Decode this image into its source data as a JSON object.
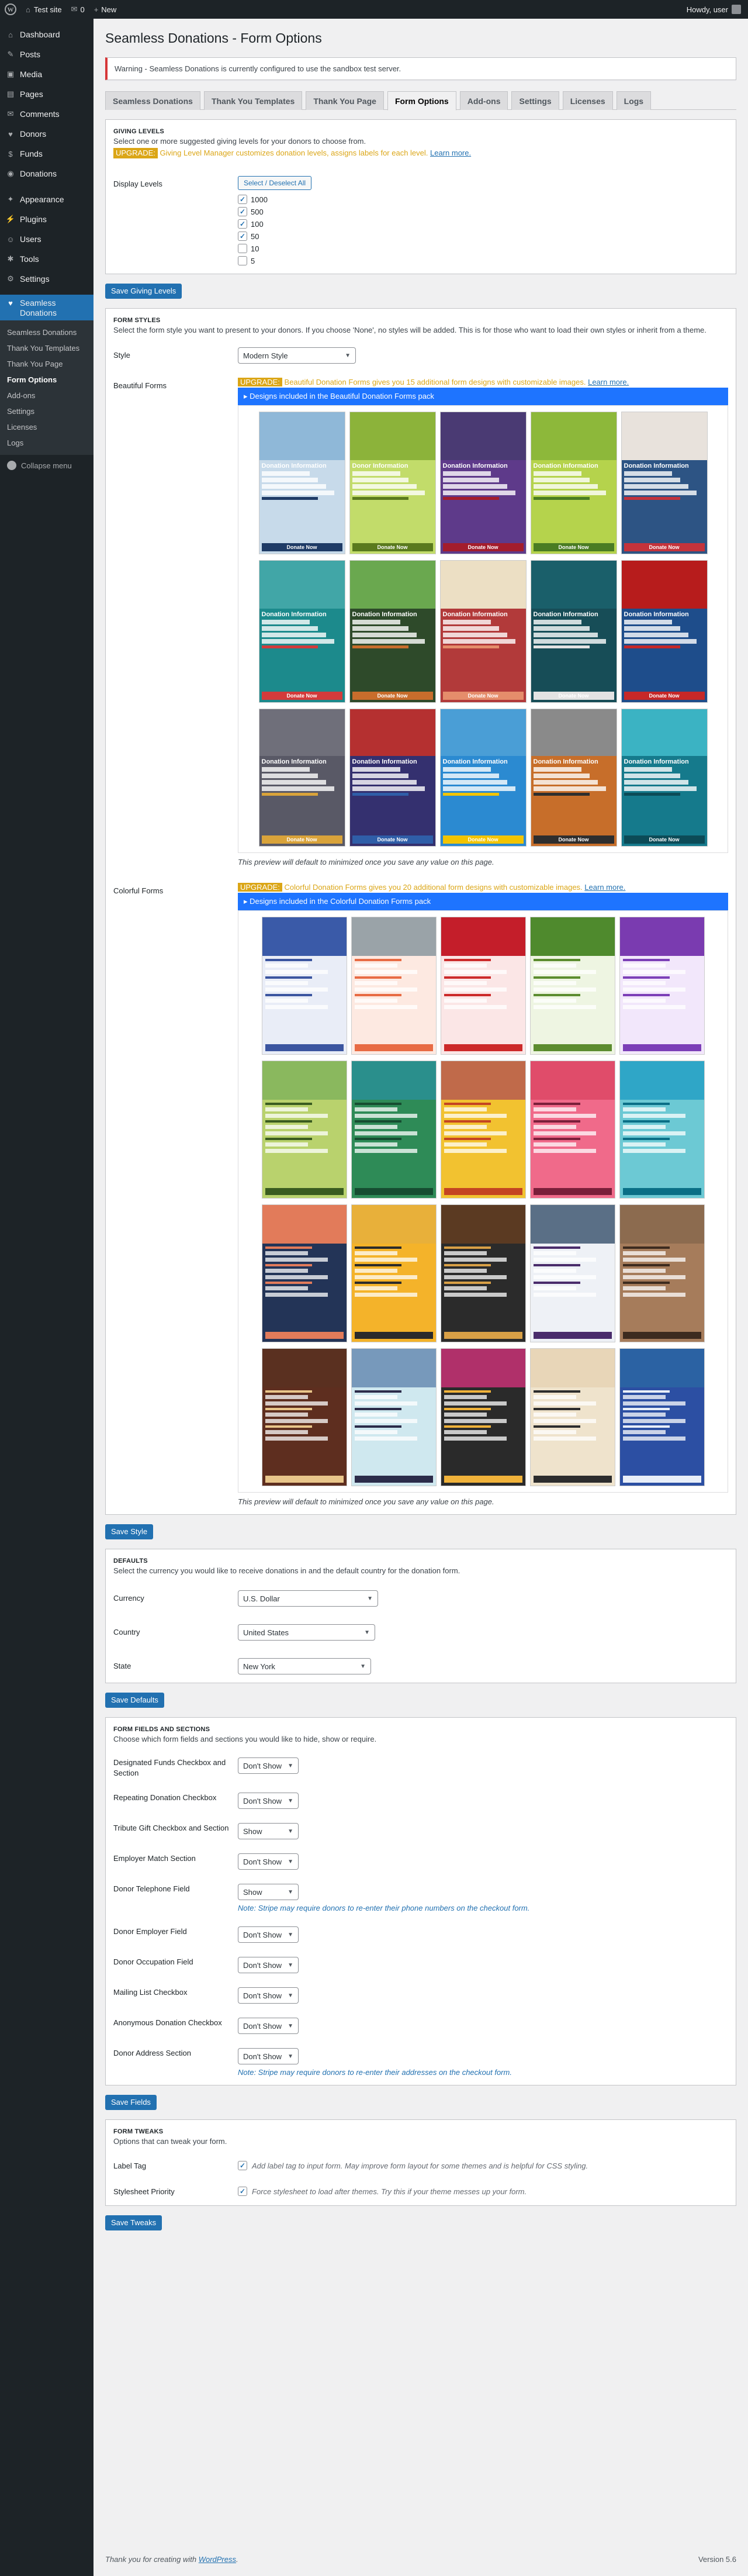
{
  "adminbar": {
    "site": "Test site",
    "comments": "0",
    "new": "New",
    "howdy": "Howdy, user"
  },
  "menu": [
    {
      "icon": "dashboard-icon",
      "glyph": "⌂",
      "label": "Dashboard"
    },
    {
      "icon": "posts-icon",
      "glyph": "✎",
      "label": "Posts"
    },
    {
      "icon": "media-icon",
      "glyph": "▣",
      "label": "Media"
    },
    {
      "icon": "pages-icon",
      "glyph": "▤",
      "label": "Pages"
    },
    {
      "icon": "comments-icon",
      "glyph": "✉",
      "label": "Comments"
    },
    {
      "icon": "donors-icon",
      "glyph": "♥",
      "label": "Donors"
    },
    {
      "icon": "funds-icon",
      "glyph": "$",
      "label": "Funds"
    },
    {
      "icon": "donations-icon",
      "glyph": "◉",
      "label": "Donations"
    },
    {
      "icon": "appearance-icon",
      "glyph": "✦",
      "label": "Appearance"
    },
    {
      "icon": "plugins-icon",
      "glyph": "⚡",
      "label": "Plugins"
    },
    {
      "icon": "users-icon",
      "glyph": "☺",
      "label": "Users"
    },
    {
      "icon": "tools-icon",
      "glyph": "✱",
      "label": "Tools"
    },
    {
      "icon": "settings-icon",
      "glyph": "⚙",
      "label": "Settings"
    }
  ],
  "active_menu": {
    "label": "Seamless Donations"
  },
  "submenu": [
    "Seamless Donations",
    "Thank You Templates",
    "Thank You Page",
    "Form Options",
    "Add-ons",
    "Settings",
    "Licenses",
    "Logs"
  ],
  "collapse": "Collapse menu",
  "page_title": "Seamless Donations - Form Options",
  "warning": "Warning - Seamless Donations is currently configured to use the sandbox test server.",
  "tabs": [
    "Seamless Donations",
    "Thank You Templates",
    "Thank You Page",
    "Form Options",
    "Add-ons",
    "Settings",
    "Licenses",
    "Logs"
  ],
  "giving": {
    "title": "GIVING LEVELS",
    "desc": "Select one or more suggested giving levels for your donors to choose from.",
    "upgrade": "UPGRADE:",
    "upgrade_text": "Giving Level Manager customizes donation levels, assigns labels for each level.",
    "learn_more": "Learn more.",
    "label": "Display Levels",
    "select_btn": "Select / Deselect All",
    "levels": [
      {
        "value": "1000",
        "checked": true
      },
      {
        "value": "500",
        "checked": true
      },
      {
        "value": "100",
        "checked": true
      },
      {
        "value": "50",
        "checked": true
      },
      {
        "value": "10",
        "checked": false
      },
      {
        "value": "5",
        "checked": false
      }
    ],
    "save": "Save Giving Levels"
  },
  "styles": {
    "title": "FORM STYLES",
    "desc": "Select the form style you want to present to your donors. If you choose 'None', no styles will be added. This is for those who want to load their own styles or inherit from a theme.",
    "style_label": "Style",
    "style_value": "Modern Style",
    "beautiful_label": "Beautiful Forms",
    "beautiful_upgrade": "UPGRADE:",
    "beautiful_text": "Beautiful Donation Forms gives you 15 additional form designs with customizable images.",
    "beautiful_pack": "▸ Designs included in the Beautiful Donation Forms pack",
    "colorful_label": "Colorful Forms",
    "colorful_upgrade": "UPGRADE:",
    "colorful_text": "Colorful Donation Forms gives you 20 additional form designs with customizable images.",
    "colorful_pack": "▸ Designs included in the Colorful Donation Forms pack",
    "learn_more": "Learn more.",
    "preview_note": "This preview will default to minimized once you save any value on this page.",
    "save": "Save Style",
    "beautiful_forms": [
      {
        "header": "Donation Information",
        "button": "Donate Now",
        "top": "#8fb8d8",
        "bg": "#c7daea",
        "accent": "#1f3b66"
      },
      {
        "header": "Donor Information",
        "button": "Donate Now",
        "top": "#8cb33a",
        "bg": "#c2dc6a",
        "accent": "#5a7a1e"
      },
      {
        "header": "Donation Information",
        "button": "Donate Now",
        "top": "#4a3a73",
        "bg": "#5e3a8a",
        "accent": "#a31d2c"
      },
      {
        "header": "Donation Information",
        "button": "Donate Now",
        "top": "#8db83a",
        "bg": "#b5d34c",
        "accent": "#4a7c23"
      },
      {
        "header": "Donation Information",
        "button": "Donate Now",
        "top": "#e8e2dc",
        "bg": "#2d5484",
        "accent": "#c4333b"
      },
      {
        "header": "Donation Information",
        "button": "Donate Now",
        "top": "#41a6a7",
        "bg": "#1c8a8c",
        "accent": "#d33b3b"
      },
      {
        "header": "Donation Information",
        "button": "Donate Now",
        "top": "#6aa84f",
        "bg": "#2e4a2a",
        "accent": "#c86d2c"
      },
      {
        "header": "Donation Information",
        "button": "Donate Now",
        "top": "#ecdfc4",
        "bg": "#b23a3a",
        "accent": "#e58d6b"
      },
      {
        "header": "Donation Information",
        "button": "Donate Now",
        "top": "#1a5f6a",
        "bg": "#174d57",
        "accent": "#e3e3e3"
      },
      {
        "header": "Donation Information",
        "button": "Donate Now",
        "top": "#b71c1c",
        "bg": "#1e4d8b",
        "accent": "#c62828"
      },
      {
        "header": "Donation Information",
        "button": "Donate Now",
        "top": "#6f6f7a",
        "bg": "#595966",
        "accent": "#d9a33a"
      },
      {
        "header": "Donation Information",
        "button": "Donate Now",
        "top": "#b53030",
        "bg": "#34306f",
        "accent": "#2f5ea8"
      },
      {
        "header": "Donation Information",
        "button": "Donate Now",
        "top": "#4a9ed6",
        "bg": "#2b8ad1",
        "accent": "#f2c400"
      },
      {
        "header": "Donation Information",
        "button": "Donate Now",
        "top": "#8a8a8a",
        "bg": "#c76e2a",
        "accent": "#2e2e2e"
      },
      {
        "header": "Donation Information",
        "button": "Donate Now",
        "top": "#3bb3c3",
        "bg": "#157a8c",
        "accent": "#0c4b57"
      }
    ],
    "colorful_forms": [
      {
        "top": "#3a5aa8",
        "bg": "#e9edf7",
        "accent": "#3b55a0"
      },
      {
        "top": "#9aa3a8",
        "bg": "#fde9e1",
        "accent": "#e86b44"
      },
      {
        "top": "#c41e2a",
        "bg": "#fbe6e6",
        "accent": "#cc2a2a"
      },
      {
        "top": "#4f8a2d",
        "bg": "#eef5e2",
        "accent": "#5c8c2f"
      },
      {
        "top": "#7a3bb0",
        "bg": "#f2e7fb",
        "accent": "#7c3fb7"
      },
      {
        "top": "#8ab85e",
        "bg": "#b9d26d",
        "accent": "#3a5c20"
      },
      {
        "top": "#2a8f8c",
        "bg": "#2e8b57",
        "accent": "#164d31"
      },
      {
        "top": "#c06a4a",
        "bg": "#f2c230",
        "accent": "#c44422"
      },
      {
        "top": "#e04c6a",
        "bg": "#f06a8a",
        "accent": "#7a1f3a"
      },
      {
        "top": "#2fa6c7",
        "bg": "#6cc9d4",
        "accent": "#0a6f86"
      },
      {
        "top": "#e27b5a",
        "bg": "#233457",
        "accent": "#e27b5a"
      },
      {
        "top": "#e8b03a",
        "bg": "#f4b32a",
        "accent": "#2b2b2b"
      },
      {
        "top": "#5b3a22",
        "bg": "#2b2b2b",
        "accent": "#d9a046"
      },
      {
        "top": "#5a6f86",
        "bg": "#eef1f6",
        "accent": "#4a2c6b"
      },
      {
        "top": "#8c6b4f",
        "bg": "#a67c5b",
        "accent": "#3d2b1f"
      },
      {
        "top": "#5a3020",
        "bg": "#5e2e1f",
        "accent": "#e8c58a"
      },
      {
        "top": "#7799bb",
        "bg": "#cfe8ef",
        "accent": "#2c2c4a"
      },
      {
        "top": "#b0306a",
        "bg": "#2a2a2a",
        "accent": "#f0b23a"
      },
      {
        "top": "#e8d6b8",
        "bg": "#efe3cc",
        "accent": "#2d2d2d"
      },
      {
        "top": "#2b62a3",
        "bg": "#2c4fa3",
        "accent": "#e8eef8"
      }
    ]
  },
  "defaults": {
    "title": "DEFAULTS",
    "desc": "Select the currency you would like to receive donations in and the default country for the donation form.",
    "currency_label": "Currency",
    "currency_value": "U.S. Dollar",
    "country_label": "Country",
    "country_value": "United States",
    "state_label": "State",
    "state_value": "New York",
    "save": "Save Defaults"
  },
  "fields": {
    "title": "FORM FIELDS AND SECTIONS",
    "desc": "Choose which form fields and sections you would like to hide, show or require.",
    "items": [
      {
        "label": "Designated Funds Checkbox and Section",
        "value": "Don't Show",
        "note": ""
      },
      {
        "label": "Repeating Donation Checkbox",
        "value": "Don't Show",
        "note": ""
      },
      {
        "label": "Tribute Gift Checkbox and Section",
        "value": "Show",
        "note": ""
      },
      {
        "label": "Employer Match Section",
        "value": "Don't Show",
        "note": ""
      },
      {
        "label": "Donor Telephone Field",
        "value": "Show",
        "note": "Note: Stripe may require donors to re-enter their phone numbers on the checkout form."
      },
      {
        "label": "Donor Employer Field",
        "value": "Don't Show",
        "note": ""
      },
      {
        "label": "Donor Occupation Field",
        "value": "Don't Show",
        "note": ""
      },
      {
        "label": "Mailing List Checkbox",
        "value": "Don't Show",
        "note": ""
      },
      {
        "label": "Anonymous Donation Checkbox",
        "value": "Don't Show",
        "note": ""
      },
      {
        "label": "Donor Address Section",
        "value": "Don't Show",
        "note": "Note: Stripe may require donors to re-enter their addresses on the checkout form."
      }
    ],
    "save": "Save Fields"
  },
  "tweaks": {
    "title": "FORM TWEAKS",
    "desc": "Options that can tweak your form.",
    "label_tag_label": "Label Tag",
    "label_tag_desc": "Add label tag to input form. May improve form layout for some themes and is helpful for CSS styling.",
    "label_tag_checked": true,
    "stylesheet_label": "Stylesheet Priority",
    "stylesheet_desc": "Force stylesheet to load after themes. Try this if your theme messes up your form.",
    "stylesheet_checked": true,
    "save": "Save Tweaks"
  },
  "footer": {
    "thanks": "Thank you for creating with",
    "wp": "WordPress",
    "version": "Version 5.6"
  }
}
